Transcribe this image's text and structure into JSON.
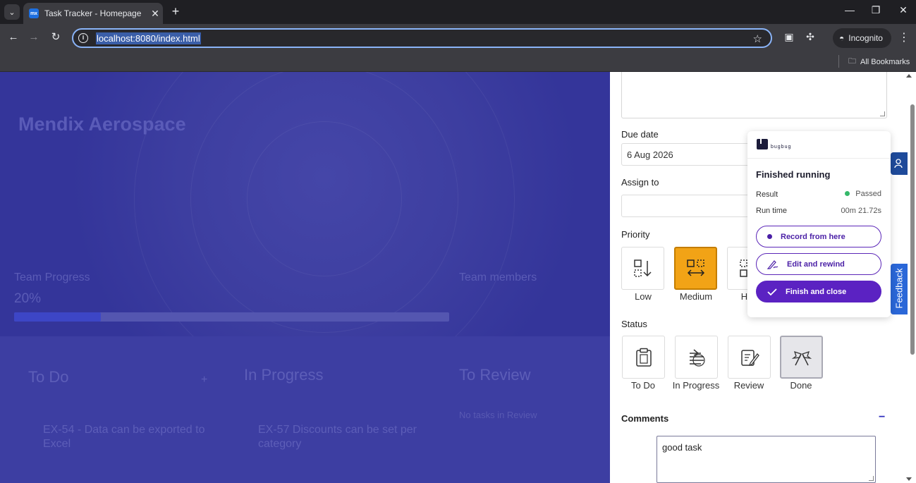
{
  "browser": {
    "tab_title": "Task Tracker - Homepage",
    "favicon_text": "mx",
    "url": "localhost:8080/index.html",
    "incognito_label": "Incognito",
    "bookmarks_label": "All Bookmarks"
  },
  "hero": {
    "title": "Mendix Aerospace",
    "team_progress_label": "Team Progress",
    "team_progress_value": "20%",
    "team_progress_fraction": 0.2,
    "team_members_label": "Team members"
  },
  "board": {
    "columns": [
      {
        "title": "To Do",
        "add": "+",
        "card": "EX-54 - Data can be exported to Excel"
      },
      {
        "title": "In Progress",
        "card": "EX-57 Discounts can be set per category"
      },
      {
        "title": "To Review",
        "empty": "No tasks in Review"
      }
    ]
  },
  "panel": {
    "due_date_label": "Due date",
    "due_date_value": "6 Aug 2026",
    "assign_label": "Assign to",
    "assign_value": "",
    "priority_label": "Priority",
    "priority_options": [
      "Low",
      "Medium",
      "Hi"
    ],
    "priority_selected": "Medium",
    "status_label": "Status",
    "status_options": [
      "To Do",
      "In Progress",
      "Review",
      "Done"
    ],
    "status_selected": "Done",
    "comments_label": "Comments",
    "comments_toggle": "−",
    "comment_text": "good task",
    "feedback_label": "Feedback"
  },
  "bugbug": {
    "brand": "bugbug",
    "title": "Finished running",
    "result_label": "Result",
    "result_value": "Passed",
    "runtime_label": "Run time",
    "runtime_value": "00m 21.72s",
    "btn_record": "Record from here",
    "btn_edit": "Edit and rewind",
    "btn_finish": "Finish and close",
    "colors": {
      "accent": "#5b22c2",
      "passed": "#35b86a"
    }
  },
  "colors": {
    "overlay": "#3b3ba3",
    "priority_medium": "#f2a316",
    "link": "#2d2dbd"
  }
}
